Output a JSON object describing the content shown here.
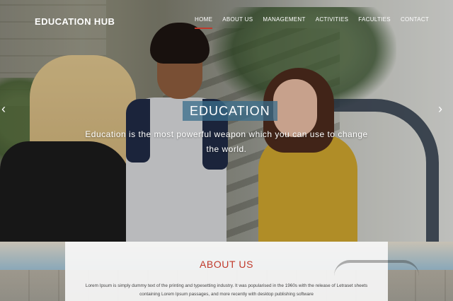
{
  "brand": {
    "logo": "EDUCATION HUB"
  },
  "nav": {
    "items": [
      {
        "label": "HOME",
        "active": true
      },
      {
        "label": "ABOUT US",
        "active": false
      },
      {
        "label": "MANAGEMENT",
        "active": false
      },
      {
        "label": "ACTIVITIES",
        "active": false
      },
      {
        "label": "FACULTIES",
        "active": false
      },
      {
        "label": "CONTACT",
        "active": false
      }
    ]
  },
  "slider": {
    "badge": "EDUCATION",
    "tagline": "Education is the most powerful weapon which you can use to change the world.",
    "prev_icon": "‹",
    "next_icon": "›"
  },
  "about": {
    "title": "ABOUT US",
    "text": "Lorem Ipsum is simply dummy text of the printing and typesetting industry. It was popularised in the 1960s with the release of Letraset sheets containing Lorem Ipsum passages, and more recently with desktop publishing software"
  },
  "colors": {
    "accent": "#c0392b",
    "badge_bg": "#3a6e8c"
  }
}
